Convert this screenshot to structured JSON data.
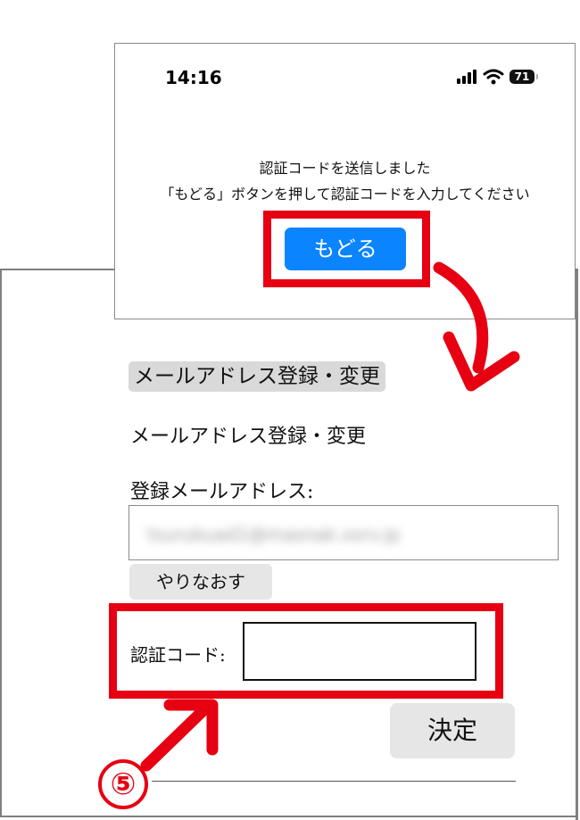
{
  "phone": {
    "status_time": "14:16",
    "battery_level": "71",
    "message_line1": "認証コードを送信しました",
    "message_line2": "「もどる」ボタンを押して認証コードを入力してください",
    "back_button_label": "もどる"
  },
  "form": {
    "section_heading": "メールアドレス登録・変更",
    "section_title": "メールアドレス登録・変更",
    "email_label": "登録メールアドレス:",
    "email_value_blurred": "tsurukuad1@masnak.xsrv.jp",
    "retry_button_label": "やりなおす",
    "code_label": "認証コード:",
    "code_value": "",
    "submit_button_label": "決定"
  },
  "annotations": {
    "step_number": "⑤",
    "highlight_color": "#e60012",
    "button_color": "#0a84ff"
  }
}
